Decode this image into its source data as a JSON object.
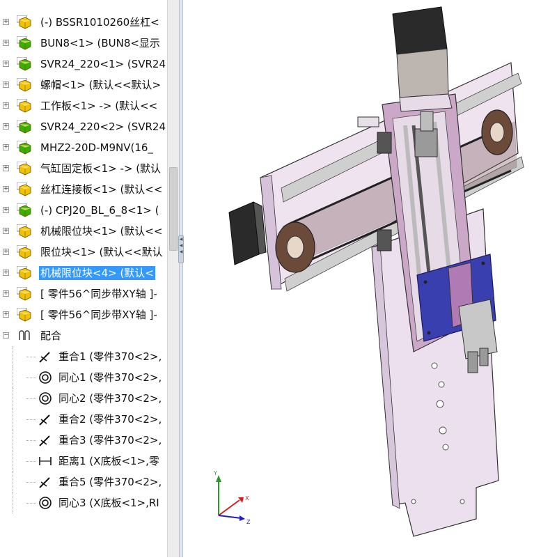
{
  "tree": {
    "items": [
      {
        "label": "(-) BSSR1010260丝杠<",
        "icon": "part-icon"
      },
      {
        "label": "BUN8<1> (BUN8<显示",
        "icon": "part-green-icon"
      },
      {
        "label": "SVR24_220<1> (SVR24",
        "icon": "part-green-icon"
      },
      {
        "label": "螺帽<1> (默认<<默认>",
        "icon": "part-icon"
      },
      {
        "label": "工作板<1> -> (默认<<",
        "icon": "part-icon"
      },
      {
        "label": "SVR24_220<2> (SVR24",
        "icon": "part-green-icon"
      },
      {
        "label": "MHZ2-20D-M9NV(16_",
        "icon": "part-green-icon"
      },
      {
        "label": "气缸固定板<1> -> (默认",
        "icon": "part-icon"
      },
      {
        "label": "丝杠连接板<1> (默认<<",
        "icon": "part-icon"
      },
      {
        "label": "(-) CPJ20_BL_6_8<1> (",
        "icon": "part-green-icon"
      },
      {
        "label": "机械限位块<1> (默认<<",
        "icon": "part-icon"
      },
      {
        "label": "限位块<1> (默认<<默认",
        "icon": "part-icon"
      },
      {
        "label": "机械限位块<4> (默认<",
        "icon": "part-icon",
        "selected": true
      },
      {
        "label": "[ 零件56^同步带XY轴 ]-",
        "icon": "part-icon"
      },
      {
        "label": "[ 零件56^同步带XY轴 ]-",
        "icon": "part-icon"
      }
    ],
    "mates_folder": {
      "label": "配合",
      "icon": "mates-icon"
    },
    "mates": [
      {
        "label": "重合1 (零件370<2>,",
        "icon": "coincident-icon"
      },
      {
        "label": "同心1 (零件370<2>,",
        "icon": "concentric-icon"
      },
      {
        "label": "同心2 (零件370<2>,",
        "icon": "concentric-icon"
      },
      {
        "label": "重合2 (零件370<2>,",
        "icon": "coincident-icon"
      },
      {
        "label": "重合3 (零件370<2>,",
        "icon": "coincident-icon"
      },
      {
        "label": "距离1 (X底板<1>,零",
        "icon": "distance-icon"
      },
      {
        "label": "重合5 (零件370<2>,",
        "icon": "coincident-icon"
      },
      {
        "label": "同心3 (X底板<1>,RI",
        "icon": "concentric-icon"
      }
    ]
  },
  "triad": {
    "x": "X",
    "y": "Y",
    "z": "Z"
  },
  "colors": {
    "selection": "#3399ff",
    "part_yellow": "#f2c200",
    "part_green": "#38b000",
    "plate_pink": "#e9d9ea",
    "motor_black": "#2a2a2a",
    "carriage_blue": "#3a3fb0"
  }
}
